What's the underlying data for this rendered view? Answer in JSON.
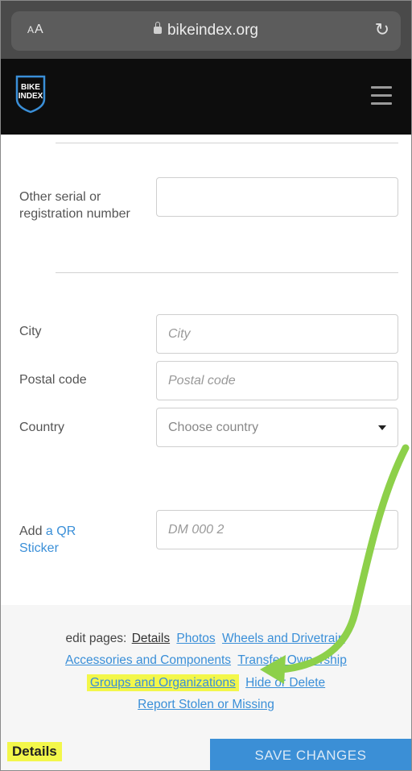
{
  "browser": {
    "text_size_label": "AA",
    "url": "bikeindex.org"
  },
  "site": {
    "logo_text_line1": "BIKE",
    "logo_text_line2": "INDEX"
  },
  "form": {
    "other_serial_label": "Other serial or registration number",
    "other_serial_value": "",
    "city_label": "City",
    "city_placeholder": "City",
    "postal_label": "Postal code",
    "postal_placeholder": "Postal code",
    "country_label": "Country",
    "country_selected": "Choose country",
    "qr_label_prefix": "Add",
    "qr_link": "a QR Sticker",
    "qr_placeholder": "DM 000 2"
  },
  "edit_pages": {
    "intro": "edit pages:",
    "details": "Details",
    "photos": "Photos",
    "wheels": "Wheels and Drivetrain",
    "accessories": "Accessories and Components",
    "transfer": "Transfer Ownership",
    "groups": "Groups and Organizations",
    "hide": "Hide or Delete",
    "report": "Report Stolen or Missing"
  },
  "footer": {
    "current_page": "Details",
    "save_label": "SAVE CHANGES"
  },
  "colors": {
    "highlight": "#f3f74a",
    "link": "#3a8fd8",
    "arrow": "#8dd04a",
    "save_button": "#3b8fd6"
  }
}
